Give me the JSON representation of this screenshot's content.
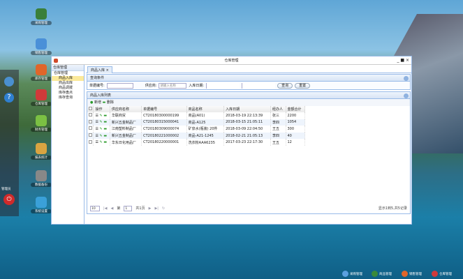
{
  "desktop_icons": [
    {
      "label": "采购管理",
      "color": "#3a7f3a"
    },
    {
      "label": "销售管理",
      "color": "#4a90d8"
    },
    {
      "label": "库存管理",
      "color": "#e0662a"
    },
    {
      "label": "仓库管理",
      "color": "#d03a3a"
    },
    {
      "label": "财务管理",
      "color": "#7bc043"
    },
    {
      "label": "报表统计",
      "color": "#d9a441"
    },
    {
      "label": "数据备份",
      "color": "#888888"
    },
    {
      "label": "系统设置",
      "color": "#3aa0d8"
    }
  ],
  "left_panel": {
    "user": "管理员"
  },
  "window": {
    "title": "仓库管理",
    "controls": "_ ■ ×"
  },
  "sidebar": {
    "title": "仓库管理",
    "items": [
      "仓库管理",
      "商品入库",
      "商品出库",
      "商品调拨",
      "库存盘点",
      "库存查询"
    ]
  },
  "tab": {
    "label": "商品入库 ×"
  },
  "query": {
    "title": "查询条件",
    "fields": [
      {
        "label": "单据编号:",
        "value": ""
      },
      {
        "label": "供应商:",
        "placeholder": "请输入名称"
      },
      {
        "label": "入库日期:",
        "value": ""
      }
    ],
    "search": "查询",
    "reset": "重置"
  },
  "list": {
    "title": "商品入库列表",
    "add": "新增",
    "delete": "删除",
    "columns": [
      "",
      "操作",
      "供应商名称",
      "单据编号",
      "商品名称",
      "入库日期",
      "经办人",
      "金额合计"
    ],
    "rows": [
      [
        "华联商贸",
        "CT20180300000199",
        "商品(A01)",
        "2018-03-19 22:13:39",
        "张三",
        "2200"
      ],
      [
        "新兴五金制品厂",
        "CT20180315000041",
        "商品-A125",
        "2018-03-15 21:05:11",
        "李四",
        "1054"
      ],
      [
        "江南塑料制品厂",
        "CT20180309000074",
        "矿泉水(瓶装) 20件",
        "2018-03-09 22:04:50",
        "王五",
        "300"
      ],
      [
        "新兴五金制品厂",
        "CT20180221000002",
        "商品-A21-1245",
        "2018-02-21 21:05:13",
        "李四",
        "40"
      ],
      [
        "华东日化用品厂",
        "CT20180220000001",
        "洗衣粉AAA6235",
        "2017-03-23 22:17:30",
        "王五",
        "12"
      ]
    ]
  },
  "pager": {
    "size": "10",
    "page_label": "第",
    "page": "1",
    "total": "共1页",
    "info": "显示1到5,共5记录"
  },
  "taskbar": [
    {
      "label": "采购管理",
      "color": "#5aa0e0"
    },
    {
      "label": "商品管理",
      "color": "#3a8a3a"
    },
    {
      "label": "销售管理",
      "color": "#e0662a"
    },
    {
      "label": "仓库管理",
      "color": "#d03a3a"
    }
  ]
}
